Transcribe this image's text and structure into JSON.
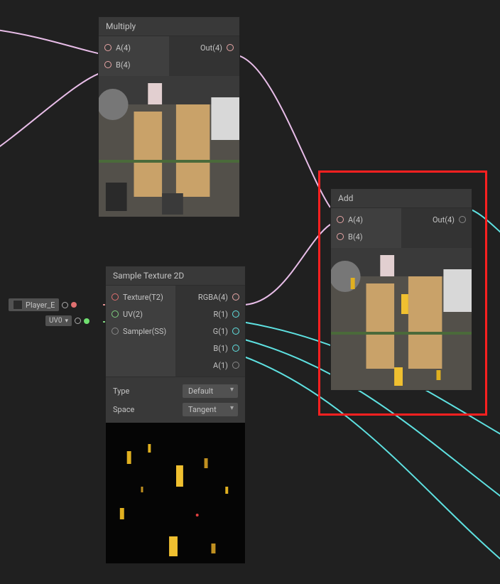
{
  "nodes": {
    "multiply": {
      "title": "Multiply",
      "inputs": {
        "a": "A(4)",
        "b": "B(4)"
      },
      "outputs": {
        "out": "Out(4)"
      }
    },
    "sample": {
      "title": "Sample Texture 2D",
      "inputs": {
        "texture": "Texture(T2)",
        "uv": "UV(2)",
        "sampler": "Sampler(SS)"
      },
      "outputs": {
        "rgba": "RGBA(4)",
        "r": "R(1)",
        "g": "G(1)",
        "b": "B(1)",
        "a": "A(1)"
      },
      "params": {
        "type_label": "Type",
        "type_value": "Default",
        "space_label": "Space",
        "space_value": "Tangent"
      }
    },
    "add": {
      "title": "Add",
      "inputs": {
        "a": "A(4)",
        "b": "B(4)"
      },
      "outputs": {
        "out": "Out(4)"
      }
    }
  },
  "externals": {
    "player_e": "Player_E",
    "uv0": "UV0"
  }
}
